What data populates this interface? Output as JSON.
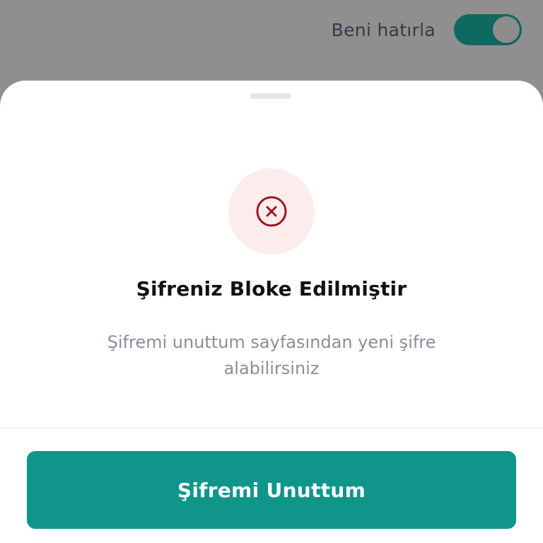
{
  "background": {
    "remember_me": {
      "label": "Beni hatırla",
      "toggle_on": true
    }
  },
  "sheet": {
    "icon": "error-x-circle-icon",
    "title": "Şifreniz Bloke Edilmiştir",
    "message": "Şifremi unuttum sayfasından yeni şifre alabilirsiniz",
    "primary_button_label": "Şifremi Unuttum"
  },
  "colors": {
    "accent": "#0f958a",
    "toggle_on": "#0e6a60",
    "error": "#a01822",
    "error_bg": "#fdecec",
    "overlay": "#8f8f8f"
  }
}
